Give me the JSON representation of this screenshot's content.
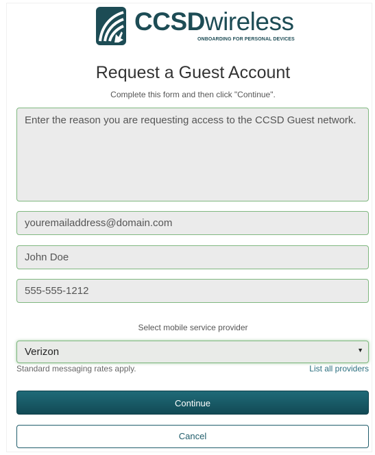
{
  "brand": {
    "bold_text": "CCSD",
    "light_text": "wireless",
    "tagline": "ONBOARDING FOR PERSONAL DEVICES",
    "icon": "wifi-hand-icon",
    "color": "#1d4c55"
  },
  "page": {
    "title": "Request a Guest Account",
    "subtitle": "Complete this form and then click \"Continue\"."
  },
  "form": {
    "reason_placeholder": "Enter the reason you are requesting access to the CCSD Guest network.",
    "email_placeholder": "youremailaddress@domain.com",
    "name_placeholder": "John Doe",
    "phone_placeholder": "555-555-1212",
    "provider_label": "Select mobile service provider",
    "provider_selected": "Verizon",
    "rates_note": "Standard messaging rates apply.",
    "list_all_link": "List all providers",
    "continue_label": "Continue",
    "cancel_label": "Cancel"
  },
  "colors": {
    "accent": "#1f6a78",
    "field_border": "#7fb77f",
    "field_bg": "#ebebeb"
  }
}
